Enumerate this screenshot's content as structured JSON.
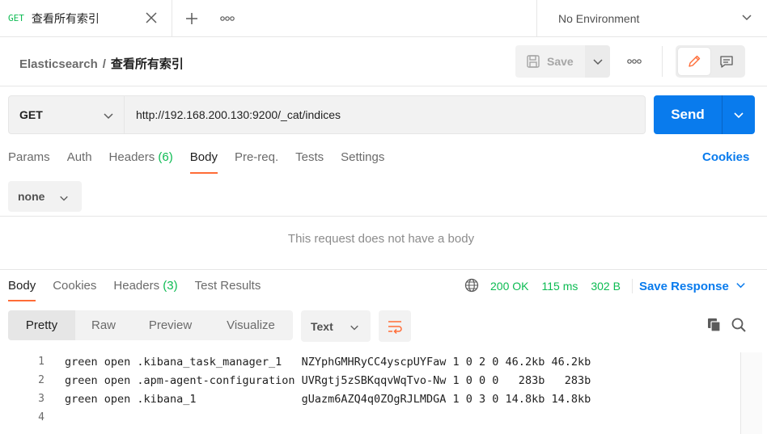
{
  "tab": {
    "method": "GET",
    "title": "查看所有索引",
    "close_glyph": "✕",
    "new_glyph": "+"
  },
  "environment": {
    "label": "No Environment"
  },
  "breadcrumb": {
    "parent": "Elasticsearch",
    "separator": "/",
    "leaf": "查看所有索引"
  },
  "toolbar": {
    "save_label": "Save"
  },
  "request": {
    "method": "GET",
    "url": "http://192.168.200.130:9200/_cat/indices",
    "send_label": "Send"
  },
  "request_tabs": [
    {
      "label": "Params"
    },
    {
      "label": "Auth"
    },
    {
      "label": "Headers",
      "count": "(6)"
    },
    {
      "label": "Body"
    },
    {
      "label": "Pre-req."
    },
    {
      "label": "Tests"
    },
    {
      "label": "Settings"
    }
  ],
  "cookies_link": "Cookies",
  "body": {
    "type": "none",
    "empty_message": "This request does not have a body"
  },
  "response_tabs": [
    {
      "label": "Body"
    },
    {
      "label": "Cookies"
    },
    {
      "label": "Headers",
      "count": "(3)"
    },
    {
      "label": "Test Results"
    }
  ],
  "response_meta": {
    "status": "200 OK",
    "time": "115 ms",
    "size": "302 B",
    "save_label": "Save Response"
  },
  "view_modes": [
    {
      "label": "Pretty"
    },
    {
      "label": "Raw"
    },
    {
      "label": "Preview"
    },
    {
      "label": "Visualize"
    }
  ],
  "format": {
    "selected": "Text"
  },
  "response_lines": [
    {
      "no": "1",
      "text": "green open .kibana_task_manager_1   NZYphGMHRyCC4yscpUYFaw 1 0 2 0 46.2kb 46.2kb"
    },
    {
      "no": "2",
      "text": "green open .apm-agent-configuration UVRgtj5zSBKqqvWqTvo-Nw 1 0 0 0   283b   283b"
    },
    {
      "no": "3",
      "text": "green open .kibana_1                gUazm6AZQ4q0ZOgRJLMDGA 1 0 3 0 14.8kb 14.8kb"
    },
    {
      "no": "4",
      "text": ""
    }
  ],
  "colors": {
    "accent": "#097bed",
    "active_tab": "#ff6c37",
    "success": "#0cbb52"
  }
}
